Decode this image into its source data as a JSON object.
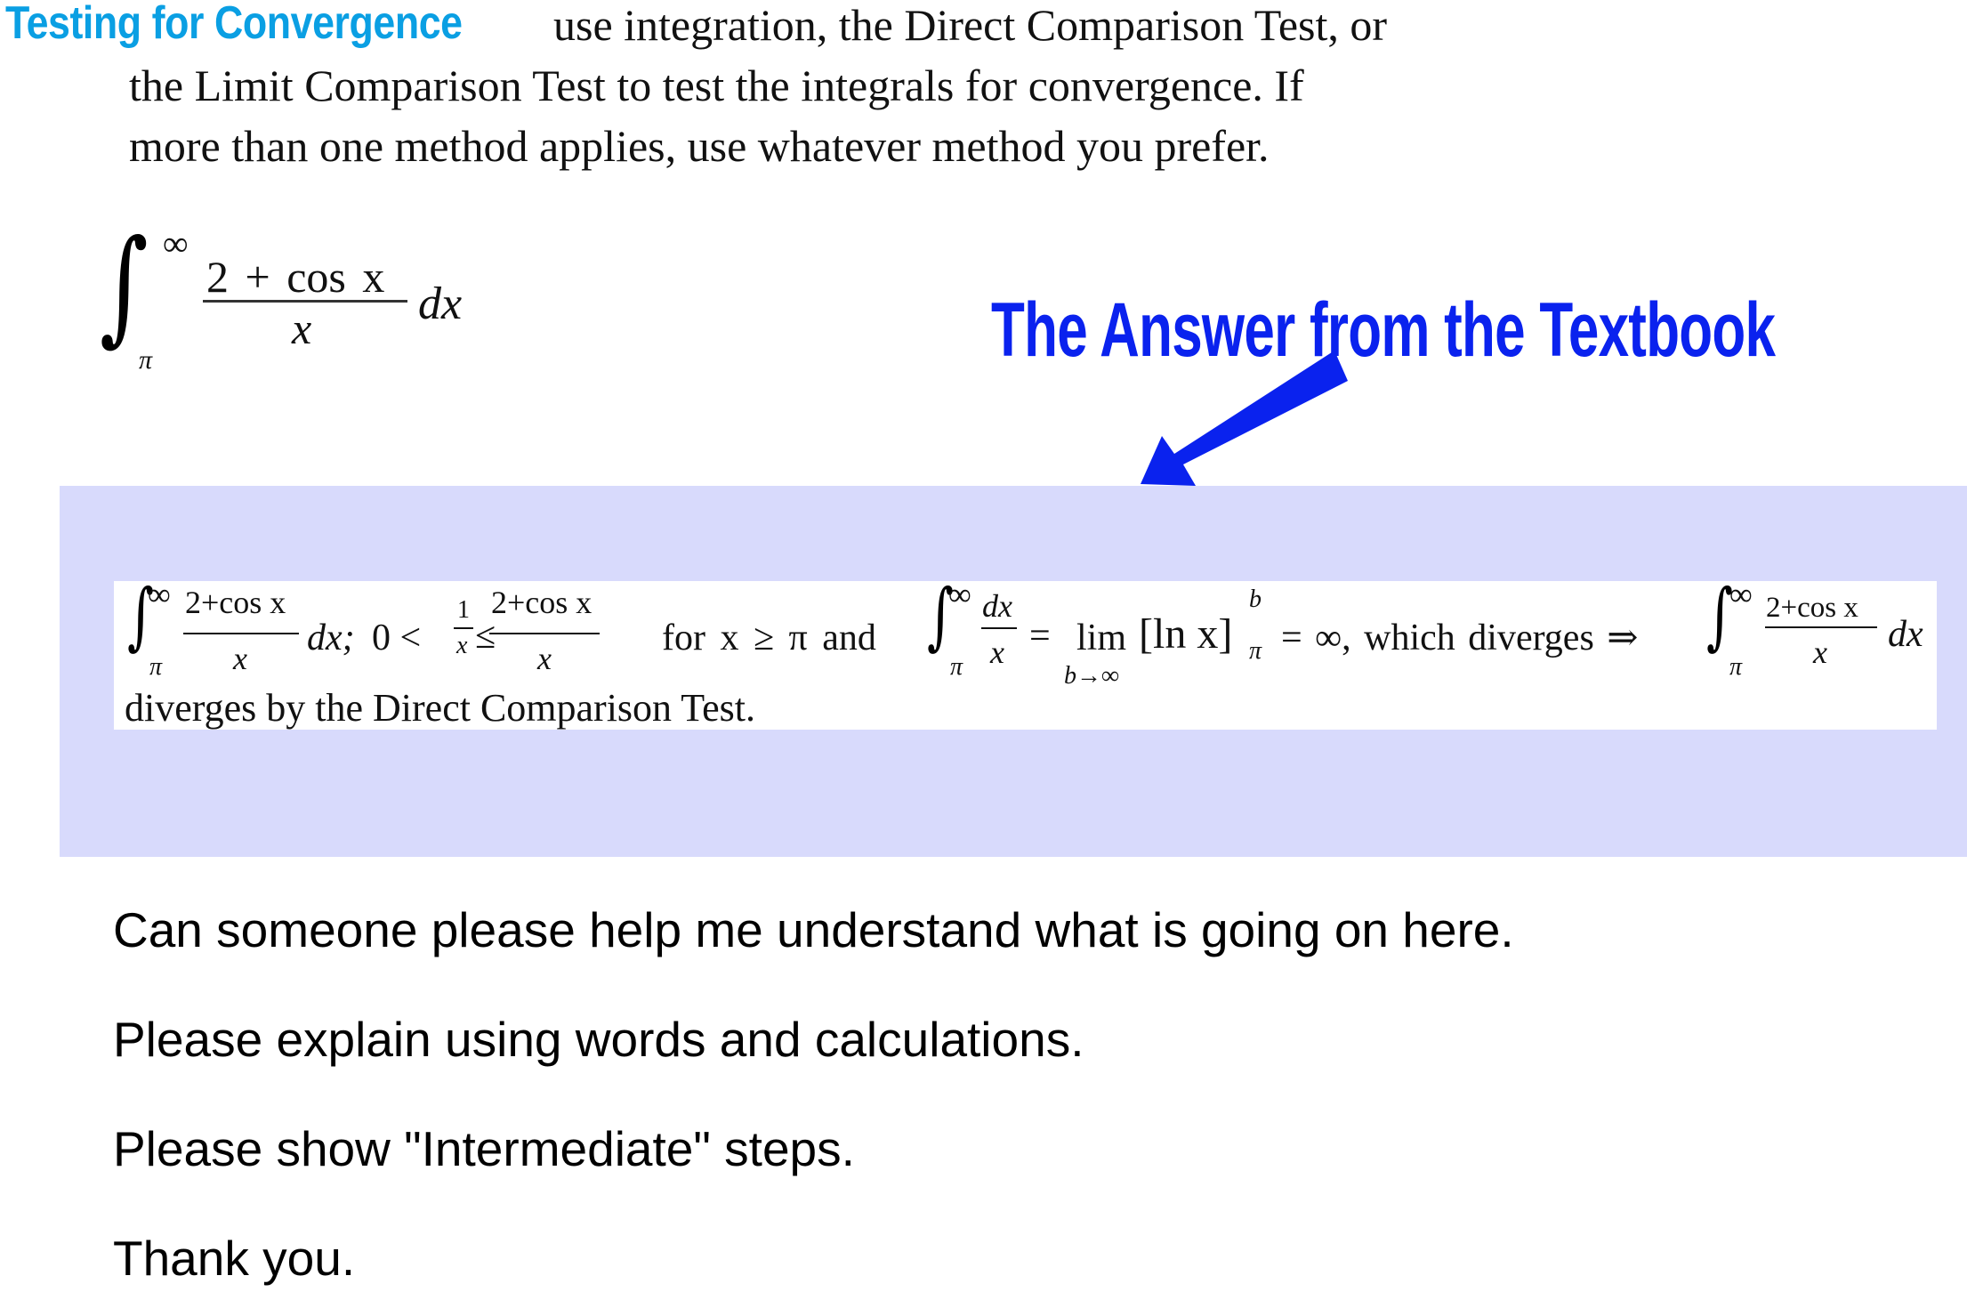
{
  "problem": {
    "heading": "Testing for Convergence",
    "instructions": [
      "use integration, the Direct Comparison Test, or",
      "the Limit Comparison Test to test the integrals for convergence. If",
      "more than one method applies, use whatever method you prefer."
    ],
    "integral": {
      "symbol": "∫",
      "upper": "∞",
      "lower": "π",
      "numerator": "2 + cos x",
      "denominator": "x",
      "differential": "dx"
    }
  },
  "annotation": {
    "label": "The Answer from the Textbook",
    "arrow_icon": "arrow-down-left-icon",
    "color": "#0a22ee"
  },
  "answer": {
    "panel_color": "#d8dafc",
    "line1": {
      "int1": {
        "symbol": "∫",
        "upper": "∞",
        "lower": "π",
        "numerator": "2+cos x",
        "denominator": "x",
        "tail": "dx;"
      },
      "ineq_start": "0 <",
      "frac_small": {
        "numerator": "1",
        "denominator": "x"
      },
      "leq": "≤",
      "frac_mid": {
        "numerator": "2+cos x",
        "denominator": "x"
      },
      "condition": "for x ≥ π  and",
      "int2": {
        "symbol": "∫",
        "upper": "∞",
        "lower": "π",
        "numerator": "dx",
        "denominator": "x"
      },
      "equals": "=",
      "lim": "lim",
      "lim_sub": "b→∞",
      "bracket": "[ln x]",
      "bracket_upper": "b",
      "bracket_lower": "π",
      "result": "= ∞,  which diverges ⇒",
      "int3": {
        "symbol": "∫",
        "upper": "∞",
        "lower": "π",
        "numerator": "2+cos x",
        "denominator": "x",
        "tail": "dx"
      }
    },
    "line2": "diverges by the Direct Comparison Test."
  },
  "question": [
    "Can someone please help me understand what is going on here.",
    "Please explain using words and calculations.",
    "Please show \"Intermediate\" steps.",
    "Thank you."
  ]
}
